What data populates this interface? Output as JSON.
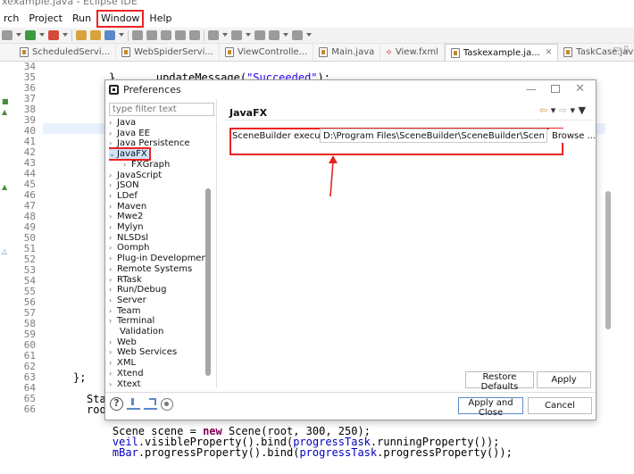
{
  "ide": {
    "title_fragment": "xexample.java - Eclipse IDE",
    "menu": [
      "rch",
      "Project",
      "Run",
      "Window",
      "Help"
    ],
    "tabs": [
      {
        "label": "ScheduledServi...",
        "active": false
      },
      {
        "label": "WebSpiderServi...",
        "active": false
      },
      {
        "label": "ViewControlle...",
        "active": false
      },
      {
        "label": "Main.java",
        "active": false
      },
      {
        "label": "View.fxml",
        "active": false
      },
      {
        "label": "Taskexample.ja...",
        "active": true
      },
      {
        "label": "TaskCase.java",
        "active": false
      }
    ],
    "tab_close": "✕",
    "window_controls": "▭ ▯"
  },
  "editor": {
    "line_numbers": [
      "34",
      "35",
      "36",
      "37",
      "38",
      "39",
      "40",
      "41",
      "42",
      "43",
      "44",
      "45",
      "46",
      "47",
      "48",
      "49",
      "50",
      "51",
      "52",
      "53",
      "54",
      "55",
      "56",
      "57",
      "58",
      "59",
      "60",
      "61",
      "62",
      "63",
      "64",
      "65",
      "66"
    ],
    "code": {
      "l34_func": "updateMessage(",
      "l34_str": "\"Succeeded\"",
      "l34_end": ");",
      "l35": "}",
      "l60": "};",
      "l62": "Sta",
      "l63": "root",
      "l64_a": "Scene scene = ",
      "l64_kw": "new",
      "l64_b": " Scene(root, 300, 250);",
      "l65_fld": "veil",
      "l65_a": ".visibleProperty().bind(",
      "l65_fld2": "progressTask",
      "l65_b": ".runningProperty());",
      "l66_fld": "mBar",
      "l66_a": ".progressProperty().bind(",
      "l66_fld2": "progressTask",
      "l66_b": ".progressProperty());"
    }
  },
  "dialog": {
    "title": "Preferences",
    "filter_placeholder": "type filter text",
    "tree": [
      {
        "label": "Java",
        "chevron": "›"
      },
      {
        "label": "Java EE",
        "chevron": "›"
      },
      {
        "label": "Java Persistence",
        "chevron": "›"
      },
      {
        "label": "JavaFX",
        "chevron": "⌄",
        "selected": true
      },
      {
        "label": "FXGraph",
        "chevron": "›",
        "child": true
      },
      {
        "label": "JavaScript",
        "chevron": "›"
      },
      {
        "label": "JSON",
        "chevron": "›"
      },
      {
        "label": "LDef",
        "chevron": "›"
      },
      {
        "label": "Maven",
        "chevron": "›"
      },
      {
        "label": "Mwe2",
        "chevron": "›"
      },
      {
        "label": "Mylyn",
        "chevron": "›"
      },
      {
        "label": "NLSDsl",
        "chevron": "›"
      },
      {
        "label": "Oomph",
        "chevron": "›"
      },
      {
        "label": "Plug-in Development",
        "chevron": "›"
      },
      {
        "label": "Remote Systems",
        "chevron": "›"
      },
      {
        "label": "RTask",
        "chevron": "›"
      },
      {
        "label": "Run/Debug",
        "chevron": "›"
      },
      {
        "label": "Server",
        "chevron": "›"
      },
      {
        "label": "Team",
        "chevron": "›"
      },
      {
        "label": "Terminal",
        "chevron": "›"
      },
      {
        "label": "Validation",
        "chevron": ""
      },
      {
        "label": "Web",
        "chevron": "›"
      },
      {
        "label": "Web Services",
        "chevron": "›"
      },
      {
        "label": "XML",
        "chevron": "›"
      },
      {
        "label": "Xtend",
        "chevron": "›"
      },
      {
        "label": "Xtext",
        "chevron": "›"
      }
    ],
    "page_title": "JavaFX",
    "nav_back": "⇦",
    "nav_fwd": "⇨",
    "nav_down": "▾",
    "nav_menu": "▾",
    "scenebuilder_label": "SceneBuilder executable",
    "scenebuilder_path": "D:\\Program Files\\SceneBuilder\\SceneBuilder\\SceneBuilder.exe",
    "browse_label": "Browse ...",
    "restore_defaults": "Restore Defaults",
    "apply": "Apply",
    "apply_and_close": "Apply and Close",
    "cancel": "Cancel",
    "help_glyph": "?",
    "min_glyph": "—",
    "close_glyph": "✕",
    "highlight_color": "#e22222"
  }
}
